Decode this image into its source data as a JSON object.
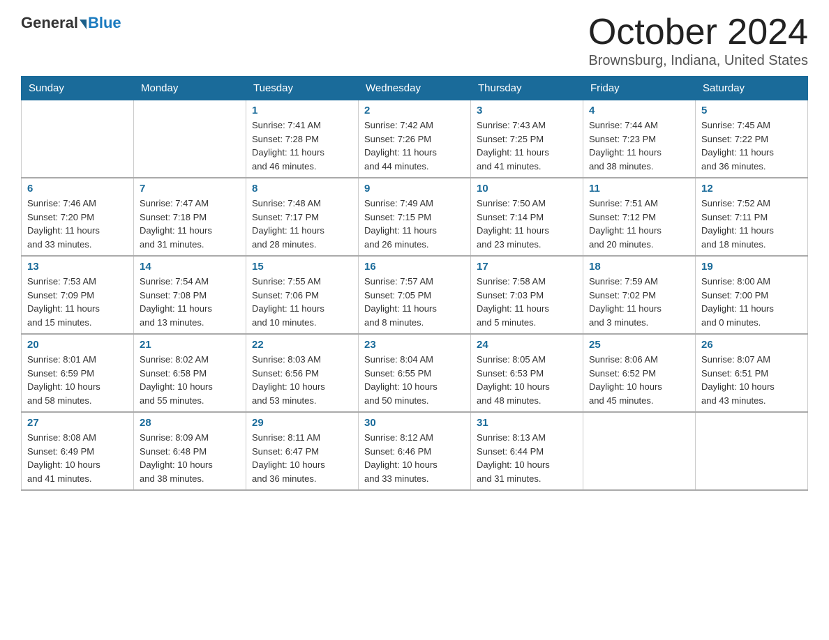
{
  "header": {
    "logo_general": "General",
    "logo_blue": "Blue",
    "month_title": "October 2024",
    "location": "Brownsburg, Indiana, United States"
  },
  "days_of_week": [
    "Sunday",
    "Monday",
    "Tuesday",
    "Wednesday",
    "Thursday",
    "Friday",
    "Saturday"
  ],
  "weeks": [
    [
      {
        "day": "",
        "info": ""
      },
      {
        "day": "",
        "info": ""
      },
      {
        "day": "1",
        "info": "Sunrise: 7:41 AM\nSunset: 7:28 PM\nDaylight: 11 hours\nand 46 minutes."
      },
      {
        "day": "2",
        "info": "Sunrise: 7:42 AM\nSunset: 7:26 PM\nDaylight: 11 hours\nand 44 minutes."
      },
      {
        "day": "3",
        "info": "Sunrise: 7:43 AM\nSunset: 7:25 PM\nDaylight: 11 hours\nand 41 minutes."
      },
      {
        "day": "4",
        "info": "Sunrise: 7:44 AM\nSunset: 7:23 PM\nDaylight: 11 hours\nand 38 minutes."
      },
      {
        "day": "5",
        "info": "Sunrise: 7:45 AM\nSunset: 7:22 PM\nDaylight: 11 hours\nand 36 minutes."
      }
    ],
    [
      {
        "day": "6",
        "info": "Sunrise: 7:46 AM\nSunset: 7:20 PM\nDaylight: 11 hours\nand 33 minutes."
      },
      {
        "day": "7",
        "info": "Sunrise: 7:47 AM\nSunset: 7:18 PM\nDaylight: 11 hours\nand 31 minutes."
      },
      {
        "day": "8",
        "info": "Sunrise: 7:48 AM\nSunset: 7:17 PM\nDaylight: 11 hours\nand 28 minutes."
      },
      {
        "day": "9",
        "info": "Sunrise: 7:49 AM\nSunset: 7:15 PM\nDaylight: 11 hours\nand 26 minutes."
      },
      {
        "day": "10",
        "info": "Sunrise: 7:50 AM\nSunset: 7:14 PM\nDaylight: 11 hours\nand 23 minutes."
      },
      {
        "day": "11",
        "info": "Sunrise: 7:51 AM\nSunset: 7:12 PM\nDaylight: 11 hours\nand 20 minutes."
      },
      {
        "day": "12",
        "info": "Sunrise: 7:52 AM\nSunset: 7:11 PM\nDaylight: 11 hours\nand 18 minutes."
      }
    ],
    [
      {
        "day": "13",
        "info": "Sunrise: 7:53 AM\nSunset: 7:09 PM\nDaylight: 11 hours\nand 15 minutes."
      },
      {
        "day": "14",
        "info": "Sunrise: 7:54 AM\nSunset: 7:08 PM\nDaylight: 11 hours\nand 13 minutes."
      },
      {
        "day": "15",
        "info": "Sunrise: 7:55 AM\nSunset: 7:06 PM\nDaylight: 11 hours\nand 10 minutes."
      },
      {
        "day": "16",
        "info": "Sunrise: 7:57 AM\nSunset: 7:05 PM\nDaylight: 11 hours\nand 8 minutes."
      },
      {
        "day": "17",
        "info": "Sunrise: 7:58 AM\nSunset: 7:03 PM\nDaylight: 11 hours\nand 5 minutes."
      },
      {
        "day": "18",
        "info": "Sunrise: 7:59 AM\nSunset: 7:02 PM\nDaylight: 11 hours\nand 3 minutes."
      },
      {
        "day": "19",
        "info": "Sunrise: 8:00 AM\nSunset: 7:00 PM\nDaylight: 11 hours\nand 0 minutes."
      }
    ],
    [
      {
        "day": "20",
        "info": "Sunrise: 8:01 AM\nSunset: 6:59 PM\nDaylight: 10 hours\nand 58 minutes."
      },
      {
        "day": "21",
        "info": "Sunrise: 8:02 AM\nSunset: 6:58 PM\nDaylight: 10 hours\nand 55 minutes."
      },
      {
        "day": "22",
        "info": "Sunrise: 8:03 AM\nSunset: 6:56 PM\nDaylight: 10 hours\nand 53 minutes."
      },
      {
        "day": "23",
        "info": "Sunrise: 8:04 AM\nSunset: 6:55 PM\nDaylight: 10 hours\nand 50 minutes."
      },
      {
        "day": "24",
        "info": "Sunrise: 8:05 AM\nSunset: 6:53 PM\nDaylight: 10 hours\nand 48 minutes."
      },
      {
        "day": "25",
        "info": "Sunrise: 8:06 AM\nSunset: 6:52 PM\nDaylight: 10 hours\nand 45 minutes."
      },
      {
        "day": "26",
        "info": "Sunrise: 8:07 AM\nSunset: 6:51 PM\nDaylight: 10 hours\nand 43 minutes."
      }
    ],
    [
      {
        "day": "27",
        "info": "Sunrise: 8:08 AM\nSunset: 6:49 PM\nDaylight: 10 hours\nand 41 minutes."
      },
      {
        "day": "28",
        "info": "Sunrise: 8:09 AM\nSunset: 6:48 PM\nDaylight: 10 hours\nand 38 minutes."
      },
      {
        "day": "29",
        "info": "Sunrise: 8:11 AM\nSunset: 6:47 PM\nDaylight: 10 hours\nand 36 minutes."
      },
      {
        "day": "30",
        "info": "Sunrise: 8:12 AM\nSunset: 6:46 PM\nDaylight: 10 hours\nand 33 minutes."
      },
      {
        "day": "31",
        "info": "Sunrise: 8:13 AM\nSunset: 6:44 PM\nDaylight: 10 hours\nand 31 minutes."
      },
      {
        "day": "",
        "info": ""
      },
      {
        "day": "",
        "info": ""
      }
    ]
  ]
}
